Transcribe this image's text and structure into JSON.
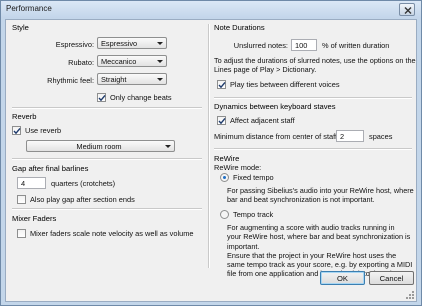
{
  "window": {
    "title": "Performance"
  },
  "style": {
    "title": "Style",
    "espressivo_label": "Espressivo:",
    "espressivo_value": "Espressivo",
    "rubato_label": "Rubato:",
    "rubato_value": "Meccanico",
    "rhythmic_label": "Rhythmic feel:",
    "rhythmic_value": "Straight",
    "only_change_beats": "Only change beats"
  },
  "reverb": {
    "title": "Reverb",
    "use_reverb": "Use reverb",
    "room_value": "Medium room"
  },
  "gap": {
    "title": "Gap after final barlines",
    "value": "4",
    "units": "quarters (crotchets)",
    "also_play_gap": "Also play gap after section ends"
  },
  "mixer": {
    "title": "Mixer Faders",
    "scale_note_velocity": "Mixer faders scale note velocity as well as volume"
  },
  "note_durations": {
    "title": "Note Durations",
    "unslurred_label": "Unslurred notes:",
    "unslurred_value": "100",
    "unslurred_units": "% of written duration",
    "info_line1": "To adjust the durations of slurred notes, use the options on the",
    "info_line2": "Lines page of Play > Dictionary.",
    "play_ties": "Play ties between different voices"
  },
  "dynamics": {
    "title": "Dynamics between keyboard staves",
    "affect_adjacent": "Affect adjacent staff",
    "min_distance_label": "Minimum distance from center of staff:",
    "min_distance_value": "2",
    "min_distance_units": "spaces"
  },
  "rewire": {
    "title": "ReWire",
    "mode_label": "ReWire mode:",
    "fixed_tempo": "Fixed tempo",
    "fixed_desc1": "For passing Sibelius's audio into your ReWire host, where",
    "fixed_desc2": "bar and beat synchronization is not important.",
    "tempo_track": "Tempo track",
    "tempo_desc1": "For augmenting a score with audio tracks running in",
    "tempo_desc2": "your ReWire host, where bar and beat synchronization is",
    "tempo_desc3": "important.",
    "tempo_desc4": "Ensure that the project in your ReWire host uses the",
    "tempo_desc5": "same tempo track as your score, e.g. by exporting a MIDI",
    "tempo_desc6": "file from one application and importing it into the other."
  },
  "buttons": {
    "ok": "OK",
    "cancel": "Cancel"
  },
  "icons": {
    "close": "close-icon",
    "checkmark": "checkmark-icon",
    "dropdown": "chevron-down-icon",
    "grip": "resize-grip-icon"
  }
}
